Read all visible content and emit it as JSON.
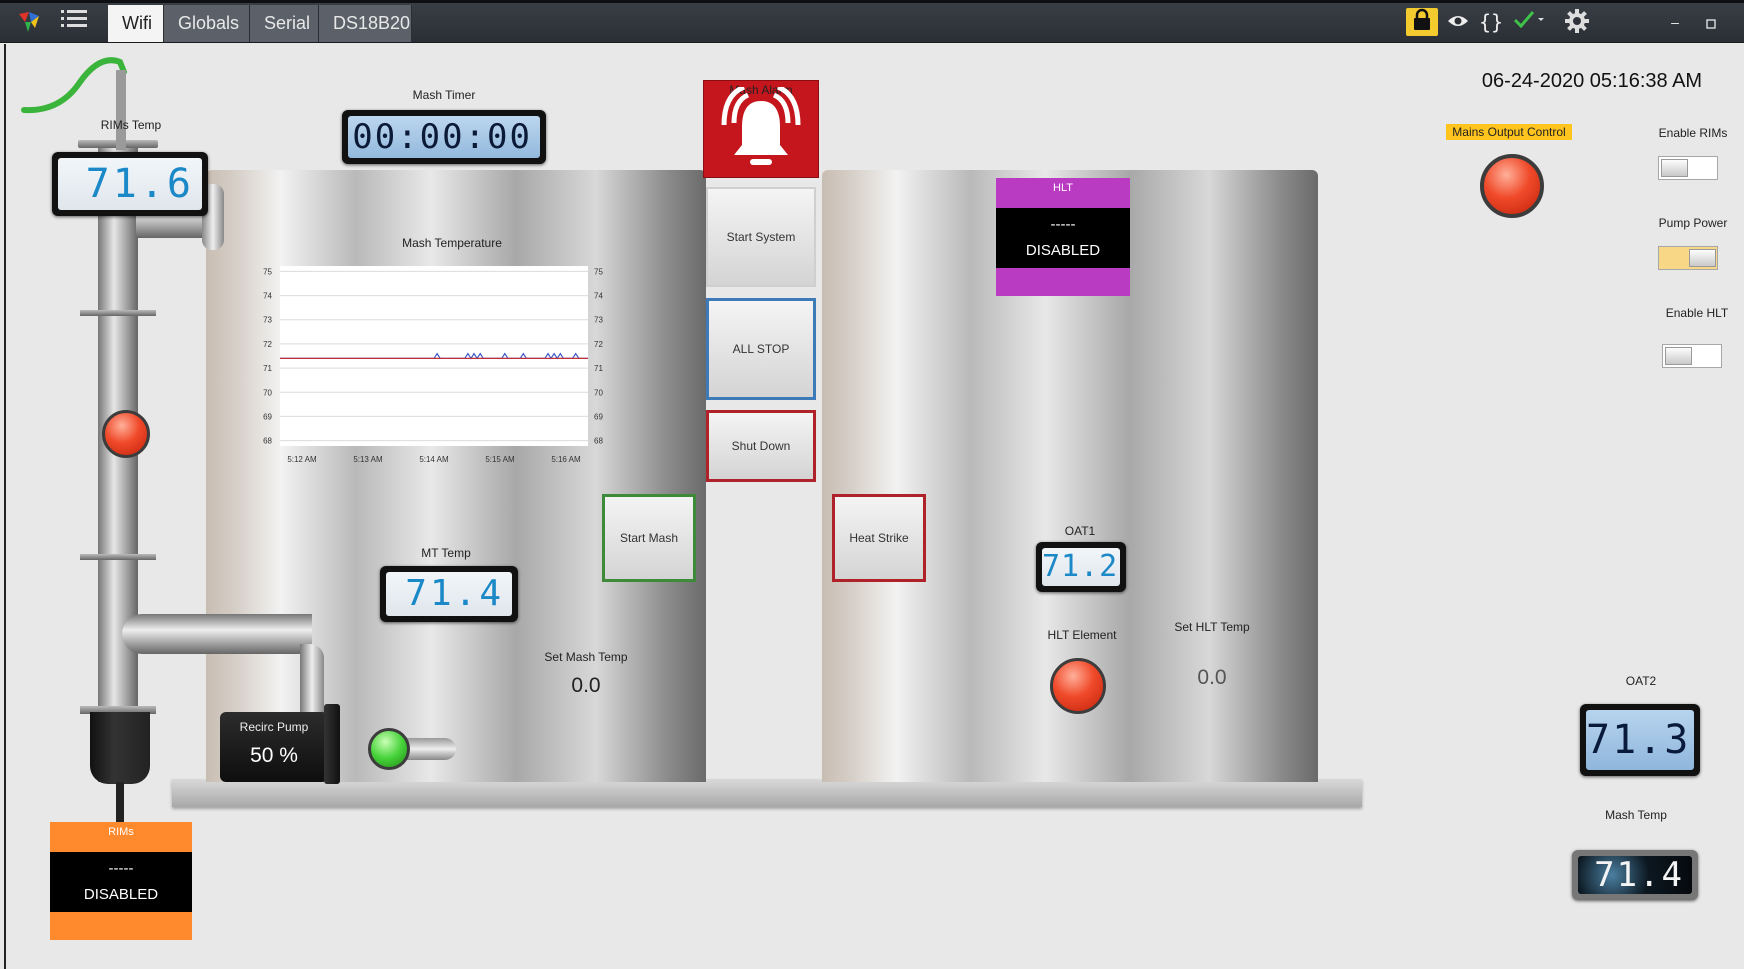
{
  "tabs": [
    {
      "label": "Wifi",
      "active": true
    },
    {
      "label": "Globals",
      "active": false
    },
    {
      "label": "Serial",
      "active": false
    },
    {
      "label": "DS18B20",
      "active": false
    }
  ],
  "datetime": "06-24-2020 05:16:38 AM",
  "rims_temp": {
    "label": "RIMs Temp",
    "value": "71.6"
  },
  "mash_timer": {
    "label": "Mash Timer",
    "value": "00:00:00"
  },
  "mash_alarm": {
    "label": "Mash Alarm"
  },
  "mash_chart": {
    "title": "Mash Temperature"
  },
  "chart_data": {
    "type": "line",
    "title": "Mash Temperature",
    "ylim": [
      68,
      75
    ],
    "y_ticks": [
      "75",
      "74",
      "73",
      "72",
      "71",
      "70",
      "69",
      "68"
    ],
    "x_ticks": [
      "5:12 AM",
      "5:13 AM",
      "5:14 AM",
      "5:15 AM",
      "5:16 AM"
    ],
    "series": [
      {
        "color": "#3a57c8",
        "x": [
          0,
          0.5,
          0.51,
          0.52,
          0.53,
          0.6,
          0.61,
          0.62,
          0.63,
          0.64,
          0.65,
          0.66,
          0.72,
          0.73,
          0.74,
          0.78,
          0.79,
          0.8,
          0.86,
          0.87,
          0.88,
          0.89,
          0.9,
          0.91,
          0.92,
          0.95,
          0.96,
          0.97,
          1.0
        ],
        "y": [
          71.4,
          71.4,
          71.6,
          71.4,
          71.4,
          71.4,
          71.6,
          71.4,
          71.6,
          71.4,
          71.6,
          71.4,
          71.4,
          71.6,
          71.4,
          71.4,
          71.6,
          71.4,
          71.4,
          71.6,
          71.4,
          71.6,
          71.4,
          71.6,
          71.4,
          71.4,
          71.6,
          71.4,
          71.4
        ]
      },
      {
        "color": "#c0303a",
        "x": [
          0,
          1
        ],
        "y": [
          71.4,
          71.4
        ]
      }
    ]
  },
  "buttons": {
    "start_system": "Start System",
    "all_stop": "ALL STOP",
    "shut_down": "Shut Down",
    "start_mash": "Start Mash",
    "heat_strike": "Heat Strike"
  },
  "hlt_card": {
    "title": "HLT",
    "dashes": "-----",
    "status": "DISABLED"
  },
  "rims_card": {
    "title": "RIMs",
    "dashes": "-----",
    "status": "DISABLED"
  },
  "mt_temp": {
    "label": "MT Temp",
    "value": "71.4"
  },
  "set_mash_temp": {
    "label": "Set Mash Temp",
    "value": "0.0"
  },
  "recirc_pump": {
    "label": "Recirc Pump",
    "value": "50 %"
  },
  "oat1": {
    "label": "OAT1",
    "value": "71.2"
  },
  "hlt_element": {
    "label": "HLT Element"
  },
  "set_hlt_temp": {
    "label": "Set HLT Temp",
    "value": "0.0"
  },
  "mains_output": {
    "label": "Mains Output Control"
  },
  "enable_rims": {
    "label": "Enable RIMs",
    "on": false
  },
  "pump_power": {
    "label": "Pump Power",
    "on": true
  },
  "enable_hlt": {
    "label": "Enable HLT",
    "on": false
  },
  "oat2": {
    "label": "OAT2",
    "value": "71.3"
  },
  "mash_temp": {
    "label": "Mash Temp",
    "value": "71.4"
  },
  "colors": {
    "hlt": "#b93bc1",
    "rims": "#ff8a2e",
    "mains_highlight": "#ffc41d",
    "alarm": "#c4161c"
  }
}
